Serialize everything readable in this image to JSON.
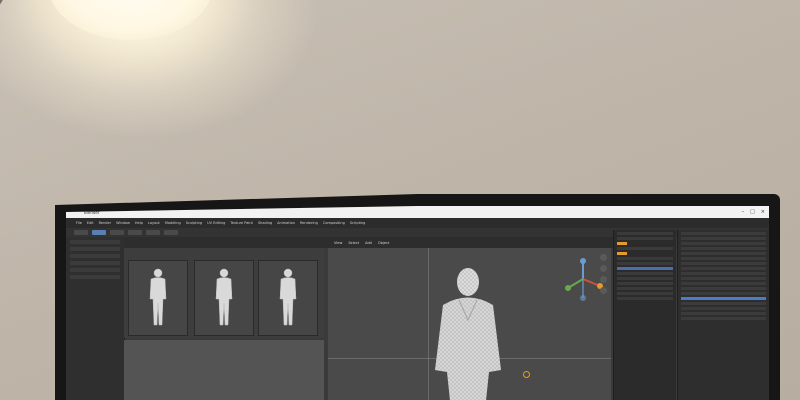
{
  "scene": {
    "description_hidden": false
  },
  "app": {
    "browser_tab": "Blender",
    "menu": [
      "File",
      "Edit",
      "Render",
      "Window",
      "Help",
      "Layout",
      "Modeling",
      "Sculpting",
      "UV Editing",
      "Texture Paint",
      "Shading",
      "Animation",
      "Rendering",
      "Compositing",
      "Scripting"
    ],
    "viewport_header": [
      "View",
      "Select",
      "Add",
      "Object"
    ],
    "colors": {
      "accent_orange": "#e39a2f",
      "accent_blue": "#4b7cc7",
      "panel_bg": "#2e2e2e",
      "viewport_bg": "#4a4a4a"
    },
    "icons": [
      "navigation-gizmo-icon",
      "zoom-icon",
      "pan-icon",
      "camera-icon",
      "grid-icon"
    ]
  }
}
